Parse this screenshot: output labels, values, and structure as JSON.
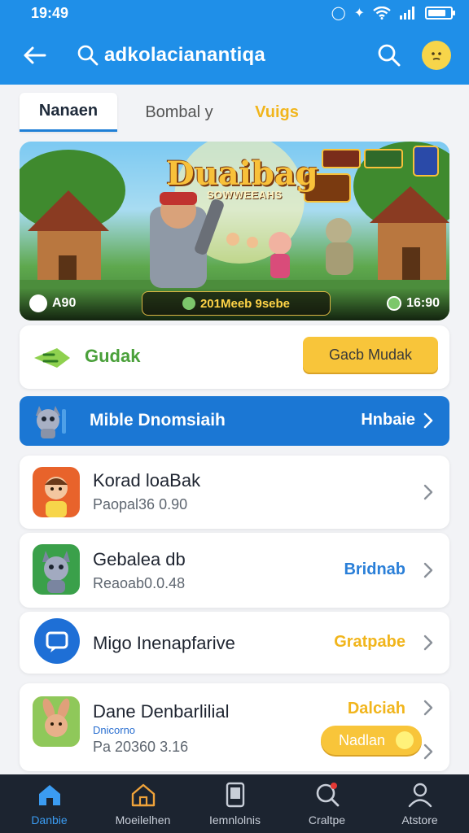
{
  "status_bar": {
    "time": "19:49",
    "battery_level": 0.8
  },
  "header": {
    "title": "adkolacianantiqa",
    "bg_color": "#1f8fe8"
  },
  "tabs": [
    {
      "label": "Nanaen",
      "active": true
    },
    {
      "label": "Bombal y",
      "active": false
    },
    {
      "label": "Vuigs",
      "active": false
    }
  ],
  "banner": {
    "title": "Duaibag",
    "subtitle": "SOWWEEAHS",
    "left_badge": "A90",
    "center_badge": "201Meeb 9sebe",
    "time": "16:90"
  },
  "action_card": {
    "label": "Gudak",
    "button_label": "Gacb Mudak",
    "accent": "#f8c53a"
  },
  "promo_bar": {
    "label": "Mible Dnomsiaih",
    "link_label": "Hnbaie",
    "color": "#1b77d4"
  },
  "list": [
    {
      "title": "Korad loaBak",
      "subtitle": "Paopal36 0.90",
      "action": "",
      "action_color": ""
    },
    {
      "title": "Gebalea db",
      "subtitle": "Reaoab0.0.48",
      "action": "Bridnab",
      "action_color": "#2a7fd8"
    },
    {
      "title": "Migo Inenapfarive",
      "subtitle": "",
      "action": "Gratpabe",
      "action_color": "#f1b51c"
    },
    {
      "title": "Dane Denbarlilial",
      "small_label": "Dnicorno",
      "subtitle": "Pa 20360 3.16",
      "action": "Dalciah",
      "action_color": "#f1b51c",
      "pill_label": "Nadlan"
    }
  ],
  "bottom_nav": [
    {
      "label": "Danbie",
      "icon": "home-icon",
      "active": true
    },
    {
      "label": "Moeilelhen",
      "icon": "house-outline-icon",
      "active": false
    },
    {
      "label": "Iemnlolnis",
      "icon": "phone-card-icon",
      "active": false
    },
    {
      "label": "Craltpe",
      "icon": "search-notification-icon",
      "active": false
    },
    {
      "label": "Atstore",
      "icon": "user-icon",
      "active": false
    }
  ]
}
